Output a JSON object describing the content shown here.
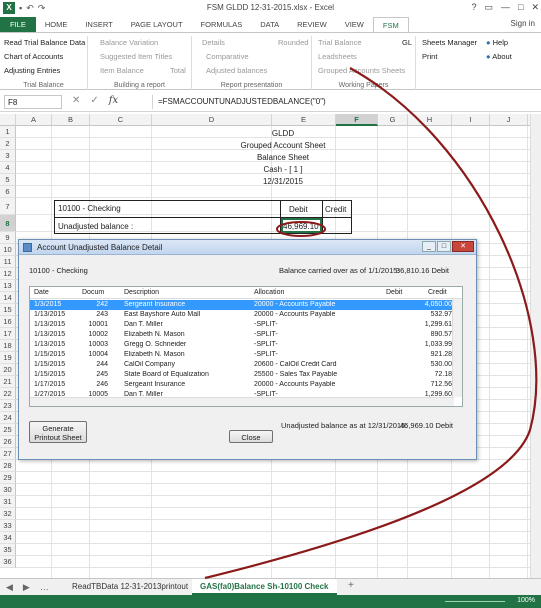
{
  "window": {
    "title": "FSM GLDD 12-31-2015.xlsx - Excel",
    "app_icon": "X",
    "qat_icons": [
      "save-icon",
      "undo-icon",
      "redo-icon"
    ],
    "controls": [
      "?",
      "▭",
      "—",
      "□",
      "✕"
    ]
  },
  "ribbon": {
    "tabs": [
      "FILE",
      "HOME",
      "INSERT",
      "PAGE LAYOUT",
      "FORMULAS",
      "DATA",
      "REVIEW",
      "VIEW",
      "FSM"
    ],
    "active_tab": "FSM",
    "signin": "Sign in",
    "groups": {
      "trial_balance": {
        "name": "Trial Balance",
        "items": [
          "Read Trial Balance Data",
          "Chart of Accounts",
          "Adjusting Entries"
        ]
      },
      "building": {
        "name": "Building a report",
        "items": [
          "Balance Variation",
          "Suggested Item Titles",
          "Item Balance",
          "Total"
        ]
      },
      "presentation": {
        "name": "Report presentation",
        "items": [
          "Details",
          "Rounded",
          "Comparative",
          "Adjusted balances"
        ]
      },
      "working": {
        "name": "Working Papers",
        "items": [
          "Trial Balance",
          "GL",
          "Leadsheets",
          "Grouped Accounts Sheets"
        ]
      },
      "misc": {
        "items": [
          "Sheets Manager",
          "Print",
          "Help",
          "About"
        ]
      }
    }
  },
  "formula_bar": {
    "name_box": "F8",
    "fx": "fx",
    "formula": "=FSMACCOUNTUNADJUSTEDBALANCE(\"0\")"
  },
  "grid": {
    "columns": [
      "A",
      "B",
      "C",
      "D",
      "E",
      "F",
      "G",
      "H",
      "I",
      "J",
      "K",
      "L"
    ],
    "selected_column": "F",
    "rows": [
      "1",
      "2",
      "3",
      "4",
      "5",
      "6",
      "7",
      "8",
      "9",
      "10",
      "11",
      "12",
      "13",
      "14",
      "15",
      "16",
      "17",
      "18",
      "19",
      "20",
      "21",
      "22",
      "23",
      "24",
      "25",
      "26",
      "27",
      "28",
      "29",
      "30",
      "31",
      "32",
      "33",
      "34",
      "35",
      "36"
    ],
    "selected_row": "8",
    "header_lines": [
      "GLDD",
      "Grouped Account Sheet",
      "Balance Sheet",
      "Cash - [ 1 ]",
      "12/31/2015"
    ],
    "account_label": "10100 - Checking",
    "debit_label": "Debit",
    "credit_label": "Credit",
    "unadjusted_label": "Unadjusted balance :",
    "unadjusted_value": "46,969.10"
  },
  "sheets": {
    "tabs": [
      "ReadTBData 12-31-2013printout",
      "GAS(fa0)Balance Sh-10100 Check"
    ],
    "active": "GAS(fa0)Balance Sh-10100 Check",
    "add_label": "+"
  },
  "status": {
    "zoom": "100%"
  },
  "dialog": {
    "title": "Account Unadjusted Balance Detail",
    "account": "10100 - Checking",
    "carried_over_label": "Balance carried over as of 1/1/2015:",
    "carried_over_value": "36,810.16 Debit",
    "columns": [
      "Date",
      "Docum",
      "Description",
      "Allocation",
      "Debit",
      "Credit"
    ],
    "rows": [
      {
        "date": "1/3/2015",
        "doc": "242",
        "desc": "Sergeant Insurance",
        "alloc": "20000 - Accounts Payable",
        "debit": "",
        "credit": "4,050.00"
      },
      {
        "date": "1/13/2015",
        "doc": "243",
        "desc": "East Bayshore Auto Mall",
        "alloc": "20000 - Accounts Payable",
        "debit": "",
        "credit": "532.97"
      },
      {
        "date": "1/13/2015",
        "doc": "10001",
        "desc": "Dan T. Miller",
        "alloc": "-SPLIT-",
        "debit": "",
        "credit": "1,299.61"
      },
      {
        "date": "1/13/2015",
        "doc": "10002",
        "desc": "Elizabeth N. Mason",
        "alloc": "-SPLIT-",
        "debit": "",
        "credit": "890.57"
      },
      {
        "date": "1/13/2015",
        "doc": "10003",
        "desc": "Gregg O. Schneider",
        "alloc": "-SPLIT-",
        "debit": "",
        "credit": "1,033.99"
      },
      {
        "date": "1/15/2015",
        "doc": "10004",
        "desc": "Elizabeth N. Mason",
        "alloc": "-SPLIT-",
        "debit": "",
        "credit": "921.28"
      },
      {
        "date": "1/15/2015",
        "doc": "244",
        "desc": "CalOil Company",
        "alloc": "20600 - CalOil Credit Card",
        "debit": "",
        "credit": "530.00"
      },
      {
        "date": "1/15/2015",
        "doc": "245",
        "desc": "State Board of Equalization",
        "alloc": "25500 - Sales Tax Payable",
        "debit": "",
        "credit": "72.18"
      },
      {
        "date": "1/17/2015",
        "doc": "246",
        "desc": "Sergeant Insurance",
        "alloc": "20000 - Accounts Payable",
        "debit": "",
        "credit": "712.56"
      },
      {
        "date": "1/27/2015",
        "doc": "10005",
        "desc": "Dan T. Miller",
        "alloc": "-SPLIT-",
        "debit": "",
        "credit": "1,299.60"
      }
    ],
    "unadjusted_label": "Unadjusted balance as at 12/31/2015:",
    "unadjusted_value": "46,969.10 Debit",
    "generate_label": "Generate\nPrintout Sheet",
    "generate_line1": "Generate",
    "generate_line2": "Printout Sheet",
    "close_label": "Close"
  },
  "colors": {
    "excel_green": "#217346",
    "annotation_red": "#8b1a1a",
    "selection_blue": "#3399ff"
  }
}
